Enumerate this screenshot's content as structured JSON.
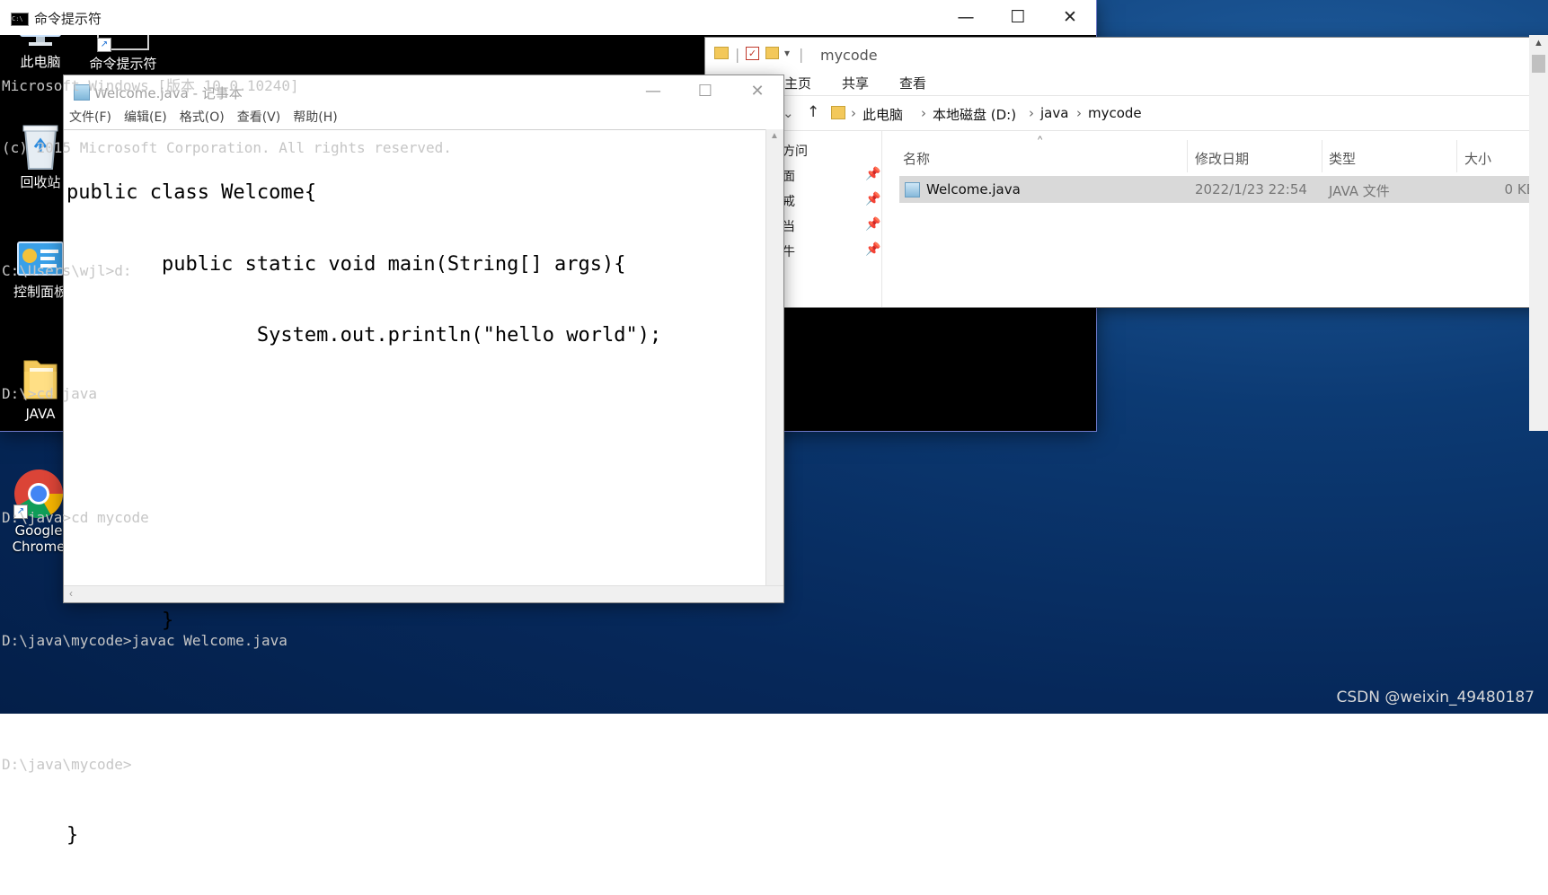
{
  "desktop": {
    "icons": [
      {
        "label": "此电脑"
      },
      {
        "label": "命令提示符"
      },
      {
        "label": "回收站"
      },
      {
        "label": "控制面板"
      },
      {
        "label": "JAVA"
      },
      {
        "label": "Google Chrome"
      }
    ]
  },
  "notepad": {
    "title": "Welcome.java - 记事本",
    "menu": [
      "文件(F)",
      "编辑(E)",
      "格式(O)",
      "查看(V)",
      "帮助(H)"
    ],
    "lines": [
      "public class Welcome{",
      "        public static void main(String[] args){",
      "                System.out.println(\"hello world\");",
      "",
      "",
      "",
      "        }",
      "",
      "",
      "}"
    ]
  },
  "explorer": {
    "title": "mycode",
    "ribbon_tabs": [
      "主页",
      "共享",
      "查看"
    ],
    "breadcrumb": [
      "此电脑",
      "本地磁盘 (D:)",
      "java",
      "mycode"
    ],
    "nav_items": [
      "方问",
      "面",
      "戒",
      "当",
      "牛"
    ],
    "columns": [
      "名称",
      "修改日期",
      "类型",
      "大小"
    ],
    "files": [
      {
        "name": "Welcome.java",
        "date": "2022/1/23 22:54",
        "type": "JAVA 文件",
        "size": "0 KB"
      }
    ]
  },
  "cmd": {
    "title": "命令提示符",
    "lines": [
      "Microsoft Windows [版本 10.0.10240]",
      "(c) 2015 Microsoft Corporation. All rights reserved.",
      "",
      "C:\\Users\\wjl>d:",
      "",
      "D:\\>cd java",
      "",
      "D:\\java>cd mycode",
      "",
      "D:\\java\\mycode>javac Welcome.java",
      "",
      "D:\\java\\mycode>"
    ]
  },
  "watermark": "CSDN @weixin_49480187"
}
